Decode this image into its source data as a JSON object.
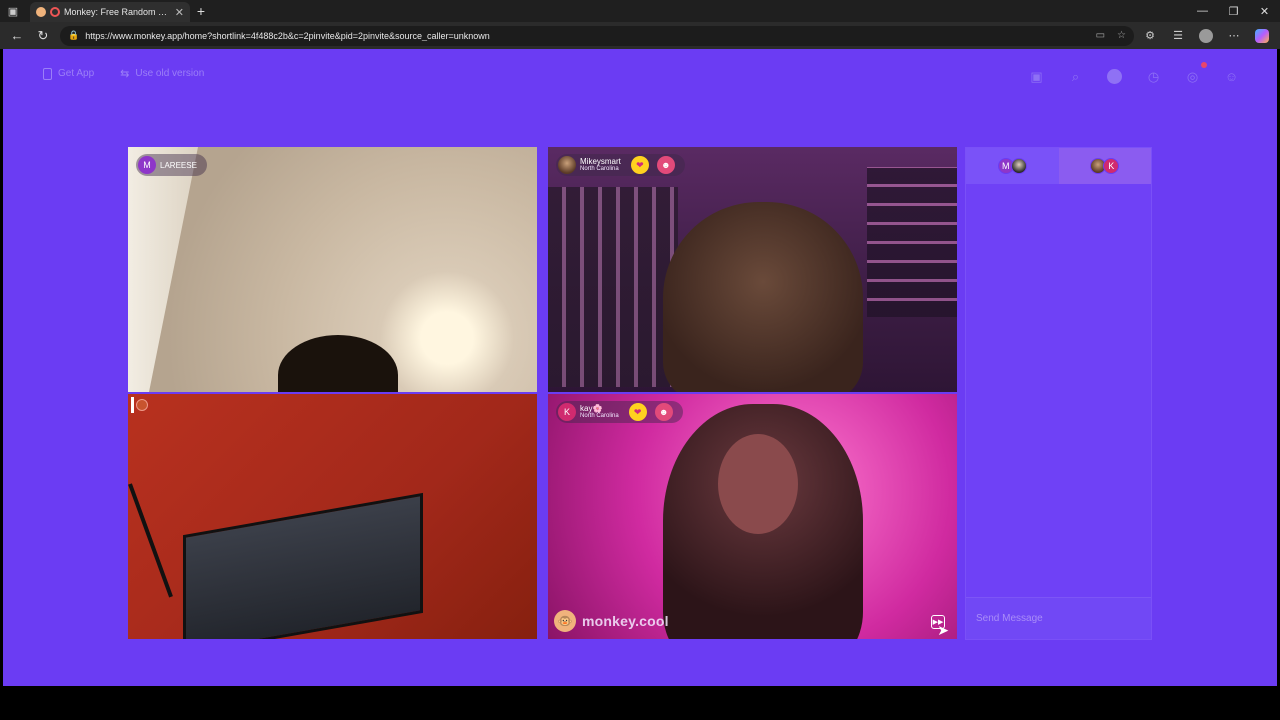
{
  "browser": {
    "tab_title": "Monkey: Free Random Video",
    "tab_close": "✕",
    "new_tab": "+",
    "url": "https://www.monkey.app/home?shortlink=4f488c2b&c=2pinvite&pid=2pinvite&source_caller=unknown",
    "window_controls": {
      "minimize": "—",
      "maximize": "❐",
      "close": "✕"
    }
  },
  "topnav": {
    "get_app": "Get App",
    "use_old_version": "Use old version"
  },
  "tiles": {
    "t1": {
      "avatar_letter": "M",
      "name": "LAREESE"
    },
    "t2": {
      "name": "Mikeysmart",
      "location": "North Carolina"
    },
    "t4": {
      "avatar_letter": "K",
      "name": "kay🌸",
      "location": "North Carolina"
    }
  },
  "watermark": {
    "text": "monkey.cool",
    "logo": "🐵"
  },
  "chat": {
    "tab1": {
      "letter": "M"
    },
    "tab2": {
      "letter": "K"
    },
    "input_placeholder": "Send Message"
  }
}
